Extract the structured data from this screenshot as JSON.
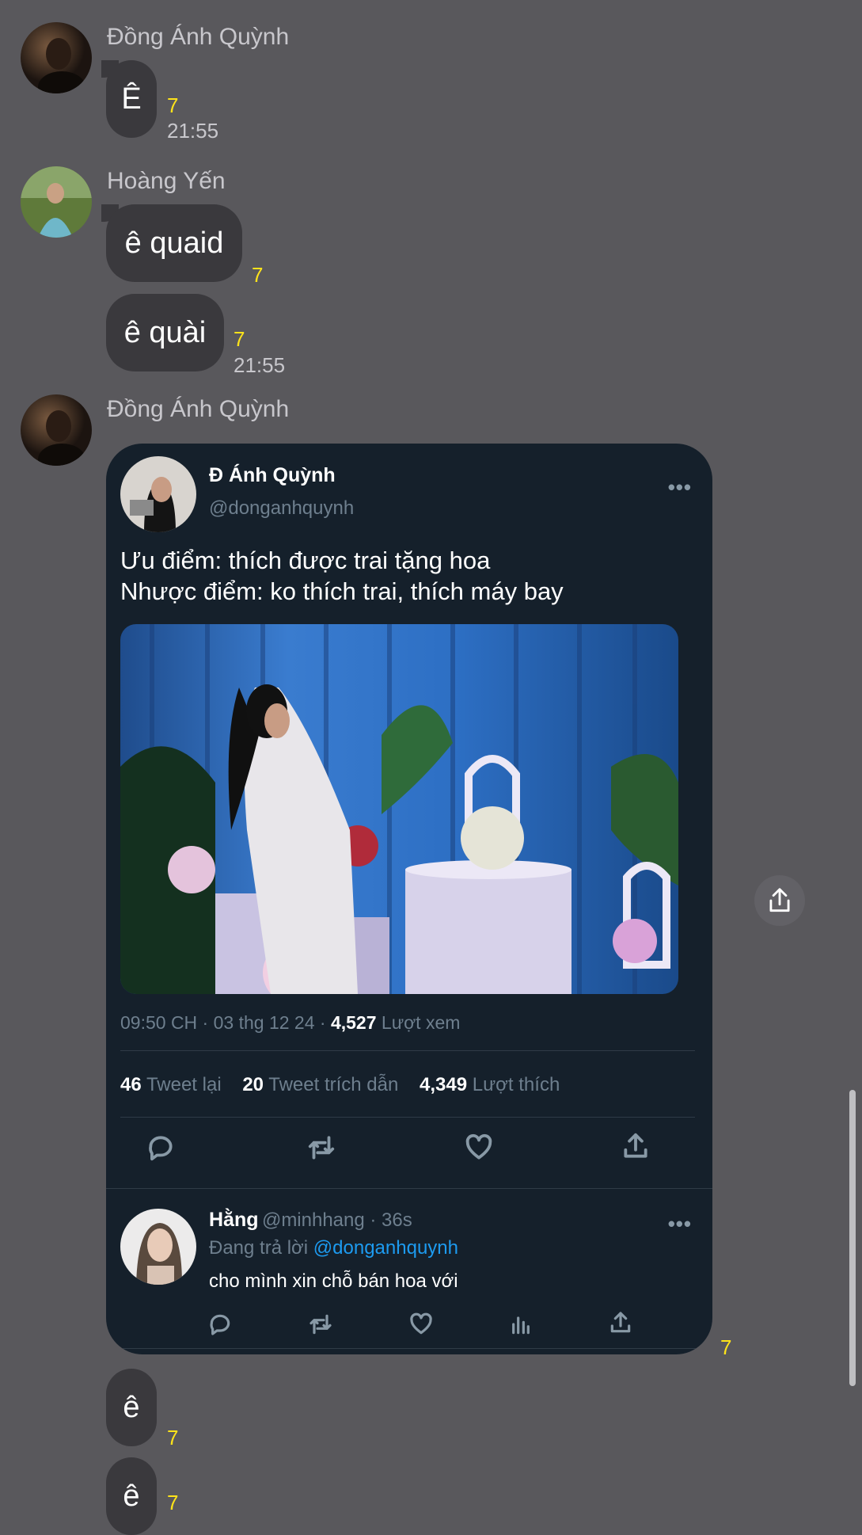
{
  "messages": [
    {
      "sender": "Đồng Ánh Quỳnh",
      "text": "Ê",
      "seen": "7",
      "time": "21:55"
    },
    {
      "sender": "Hoàng Yến",
      "text": "ê quaid",
      "seen": "7"
    },
    {
      "text": "ê quài",
      "seen": "7",
      "time": "21:55"
    },
    {
      "sender": "Đồng Ánh Quỳnh"
    },
    {
      "text": "ê",
      "seen": "7"
    },
    {
      "text": "ê",
      "seen": "7"
    }
  ],
  "tweet": {
    "name": "Đ Ánh Quỳnh",
    "handle": "@donganhquynh",
    "more": "•••",
    "text_line1": "Ưu điểm: thích được trai tặng hoa",
    "text_line2": "Nhược điểm: ko thích trai, thích máy bay",
    "meta_time": "09:50 CH · 03 thg 12 24 ·",
    "meta_views_num": "4,527",
    "meta_views_label": "Lượt xem",
    "retweets_num": "46",
    "retweets_label": "Tweet lại",
    "quotes_num": "20",
    "quotes_label": "Tweet trích dẫn",
    "likes_num": "4,349",
    "likes_label": "Lượt thích",
    "seen": "7"
  },
  "reply": {
    "name": "Hằng",
    "meta": "@minhhang · 36s",
    "replying_prefix": "Đang trả lời",
    "replying_handle": "@donganhquynh",
    "text": "cho mình xin chỗ bán hoa với",
    "more": "•••"
  },
  "colors": {
    "background": "#59585c",
    "bubble": "#3a393d",
    "seen": "#ffe31a",
    "tweet_bg": "#15202b",
    "link": "#1d9bf0"
  }
}
